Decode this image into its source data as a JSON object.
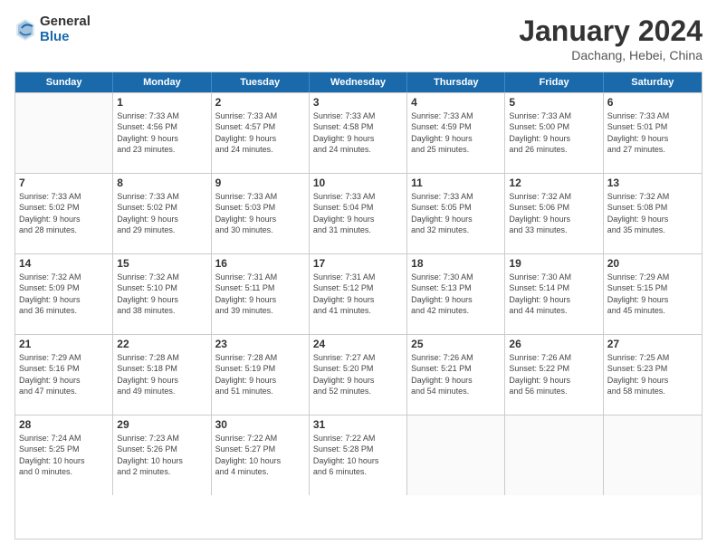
{
  "logo": {
    "general": "General",
    "blue": "Blue"
  },
  "header": {
    "month": "January 2024",
    "location": "Dachang, Hebei, China"
  },
  "weekdays": [
    "Sunday",
    "Monday",
    "Tuesday",
    "Wednesday",
    "Thursday",
    "Friday",
    "Saturday"
  ],
  "weeks": [
    [
      {
        "day": "",
        "sunrise": "",
        "sunset": "",
        "daylight": ""
      },
      {
        "day": "1",
        "sunrise": "Sunrise: 7:33 AM",
        "sunset": "Sunset: 4:56 PM",
        "daylight": "Daylight: 9 hours and 23 minutes."
      },
      {
        "day": "2",
        "sunrise": "Sunrise: 7:33 AM",
        "sunset": "Sunset: 4:57 PM",
        "daylight": "Daylight: 9 hours and 24 minutes."
      },
      {
        "day": "3",
        "sunrise": "Sunrise: 7:33 AM",
        "sunset": "Sunset: 4:58 PM",
        "daylight": "Daylight: 9 hours and 24 minutes."
      },
      {
        "day": "4",
        "sunrise": "Sunrise: 7:33 AM",
        "sunset": "Sunset: 4:59 PM",
        "daylight": "Daylight: 9 hours and 25 minutes."
      },
      {
        "day": "5",
        "sunrise": "Sunrise: 7:33 AM",
        "sunset": "Sunset: 5:00 PM",
        "daylight": "Daylight: 9 hours and 26 minutes."
      },
      {
        "day": "6",
        "sunrise": "Sunrise: 7:33 AM",
        "sunset": "Sunset: 5:01 PM",
        "daylight": "Daylight: 9 hours and 27 minutes."
      }
    ],
    [
      {
        "day": "7",
        "sunrise": "Sunrise: 7:33 AM",
        "sunset": "Sunset: 5:02 PM",
        "daylight": "Daylight: 9 hours and 28 minutes."
      },
      {
        "day": "8",
        "sunrise": "Sunrise: 7:33 AM",
        "sunset": "Sunset: 5:02 PM",
        "daylight": "Daylight: 9 hours and 29 minutes."
      },
      {
        "day": "9",
        "sunrise": "Sunrise: 7:33 AM",
        "sunset": "Sunset: 5:03 PM",
        "daylight": "Daylight: 9 hours and 30 minutes."
      },
      {
        "day": "10",
        "sunrise": "Sunrise: 7:33 AM",
        "sunset": "Sunset: 5:04 PM",
        "daylight": "Daylight: 9 hours and 31 minutes."
      },
      {
        "day": "11",
        "sunrise": "Sunrise: 7:33 AM",
        "sunset": "Sunset: 5:05 PM",
        "daylight": "Daylight: 9 hours and 32 minutes."
      },
      {
        "day": "12",
        "sunrise": "Sunrise: 7:32 AM",
        "sunset": "Sunset: 5:06 PM",
        "daylight": "Daylight: 9 hours and 33 minutes."
      },
      {
        "day": "13",
        "sunrise": "Sunrise: 7:32 AM",
        "sunset": "Sunset: 5:08 PM",
        "daylight": "Daylight: 9 hours and 35 minutes."
      }
    ],
    [
      {
        "day": "14",
        "sunrise": "Sunrise: 7:32 AM",
        "sunset": "Sunset: 5:09 PM",
        "daylight": "Daylight: 9 hours and 36 minutes."
      },
      {
        "day": "15",
        "sunrise": "Sunrise: 7:32 AM",
        "sunset": "Sunset: 5:10 PM",
        "daylight": "Daylight: 9 hours and 38 minutes."
      },
      {
        "day": "16",
        "sunrise": "Sunrise: 7:31 AM",
        "sunset": "Sunset: 5:11 PM",
        "daylight": "Daylight: 9 hours and 39 minutes."
      },
      {
        "day": "17",
        "sunrise": "Sunrise: 7:31 AM",
        "sunset": "Sunset: 5:12 PM",
        "daylight": "Daylight: 9 hours and 41 minutes."
      },
      {
        "day": "18",
        "sunrise": "Sunrise: 7:30 AM",
        "sunset": "Sunset: 5:13 PM",
        "daylight": "Daylight: 9 hours and 42 minutes."
      },
      {
        "day": "19",
        "sunrise": "Sunrise: 7:30 AM",
        "sunset": "Sunset: 5:14 PM",
        "daylight": "Daylight: 9 hours and 44 minutes."
      },
      {
        "day": "20",
        "sunrise": "Sunrise: 7:29 AM",
        "sunset": "Sunset: 5:15 PM",
        "daylight": "Daylight: 9 hours and 45 minutes."
      }
    ],
    [
      {
        "day": "21",
        "sunrise": "Sunrise: 7:29 AM",
        "sunset": "Sunset: 5:16 PM",
        "daylight": "Daylight: 9 hours and 47 minutes."
      },
      {
        "day": "22",
        "sunrise": "Sunrise: 7:28 AM",
        "sunset": "Sunset: 5:18 PM",
        "daylight": "Daylight: 9 hours and 49 minutes."
      },
      {
        "day": "23",
        "sunrise": "Sunrise: 7:28 AM",
        "sunset": "Sunset: 5:19 PM",
        "daylight": "Daylight: 9 hours and 51 minutes."
      },
      {
        "day": "24",
        "sunrise": "Sunrise: 7:27 AM",
        "sunset": "Sunset: 5:20 PM",
        "daylight": "Daylight: 9 hours and 52 minutes."
      },
      {
        "day": "25",
        "sunrise": "Sunrise: 7:26 AM",
        "sunset": "Sunset: 5:21 PM",
        "daylight": "Daylight: 9 hours and 54 minutes."
      },
      {
        "day": "26",
        "sunrise": "Sunrise: 7:26 AM",
        "sunset": "Sunset: 5:22 PM",
        "daylight": "Daylight: 9 hours and 56 minutes."
      },
      {
        "day": "27",
        "sunrise": "Sunrise: 7:25 AM",
        "sunset": "Sunset: 5:23 PM",
        "daylight": "Daylight: 9 hours and 58 minutes."
      }
    ],
    [
      {
        "day": "28",
        "sunrise": "Sunrise: 7:24 AM",
        "sunset": "Sunset: 5:25 PM",
        "daylight": "Daylight: 10 hours and 0 minutes."
      },
      {
        "day": "29",
        "sunrise": "Sunrise: 7:23 AM",
        "sunset": "Sunset: 5:26 PM",
        "daylight": "Daylight: 10 hours and 2 minutes."
      },
      {
        "day": "30",
        "sunrise": "Sunrise: 7:22 AM",
        "sunset": "Sunset: 5:27 PM",
        "daylight": "Daylight: 10 hours and 4 minutes."
      },
      {
        "day": "31",
        "sunrise": "Sunrise: 7:22 AM",
        "sunset": "Sunset: 5:28 PM",
        "daylight": "Daylight: 10 hours and 6 minutes."
      },
      {
        "day": "",
        "sunrise": "",
        "sunset": "",
        "daylight": ""
      },
      {
        "day": "",
        "sunrise": "",
        "sunset": "",
        "daylight": ""
      },
      {
        "day": "",
        "sunrise": "",
        "sunset": "",
        "daylight": ""
      }
    ]
  ]
}
